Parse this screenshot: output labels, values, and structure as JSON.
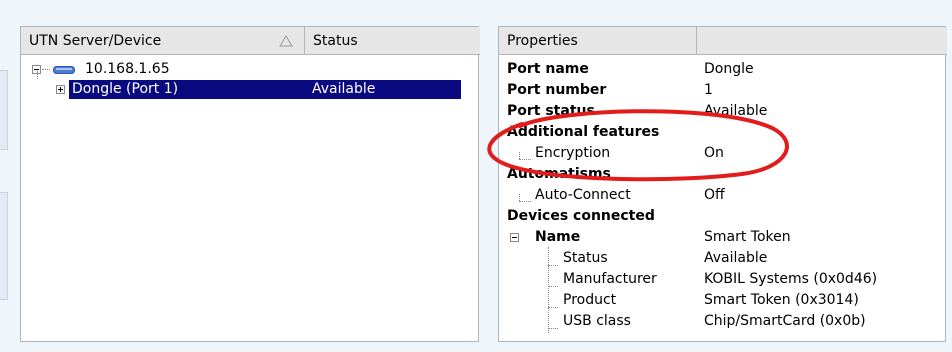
{
  "left_panel": {
    "headers": {
      "device": "UTN Server/Device",
      "status": "Status"
    },
    "server": {
      "name": "10.168.1.65"
    },
    "device": {
      "name": "Dongle (Port 1)",
      "status": "Available"
    }
  },
  "right_panel": {
    "headers": {
      "properties": "Properties",
      "value": ""
    },
    "rows": {
      "port_name": {
        "label": "Port name",
        "value": "Dongle"
      },
      "port_number": {
        "label": "Port number",
        "value": "1"
      },
      "port_status": {
        "label": "Port status",
        "value": "Available"
      },
      "additional_features": {
        "label": "Additional features"
      },
      "encryption": {
        "label": "Encryption",
        "value": "On"
      },
      "automatisms": {
        "label": "Automatisms"
      },
      "auto_connect": {
        "label": "Auto-Connect",
        "value": "Off"
      },
      "devices_connected": {
        "label": "Devices connected"
      },
      "name": {
        "label": "Name",
        "value": "Smart Token"
      },
      "status": {
        "label": "Status",
        "value": "Available"
      },
      "manufacturer": {
        "label": "Manufacturer",
        "value": "KOBIL Systems (0x0d46)"
      },
      "product": {
        "label": "Product",
        "value": "Smart Token (0x3014)"
      },
      "usb_class": {
        "label": "USB class",
        "value": "Chip/SmartCard (0x0b)"
      }
    }
  },
  "annotation": {
    "color": "#e21b1b"
  },
  "colors": {
    "selection": "#0a0a80",
    "background": "#eef5fb"
  }
}
